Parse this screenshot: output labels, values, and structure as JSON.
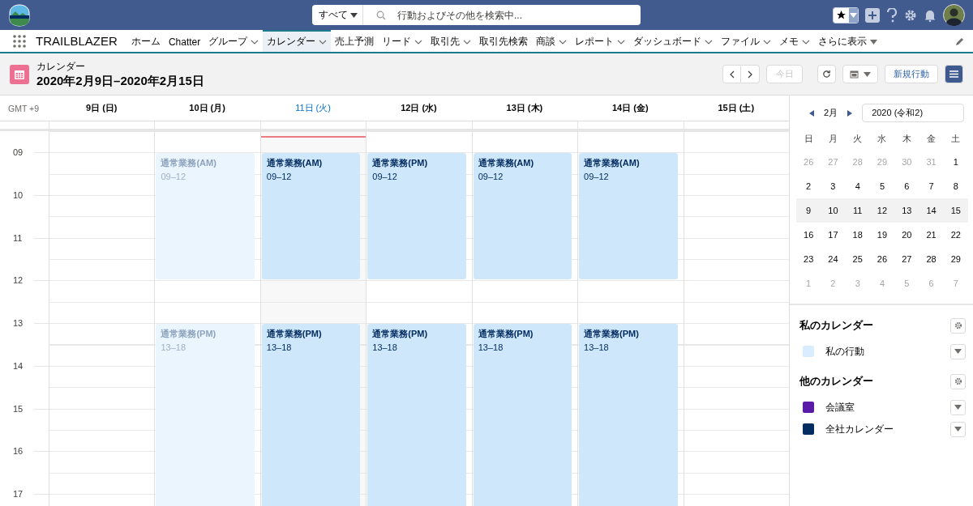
{
  "top_bar": {
    "search": {
      "scope": "すべて",
      "placeholder": "行動およびその他を検索中..."
    }
  },
  "nav": {
    "app_name": "TRAILBLAZER",
    "items": [
      {
        "label": "ホーム",
        "selected": false,
        "kind": "plain"
      },
      {
        "label": "Chatter",
        "selected": false,
        "kind": "plain"
      },
      {
        "label": "グループ",
        "selected": false,
        "kind": "menu"
      },
      {
        "label": "カレンダー",
        "selected": true,
        "kind": "menu"
      },
      {
        "label": "売上予測",
        "selected": false,
        "kind": "plain"
      },
      {
        "label": "リード",
        "selected": false,
        "kind": "menu"
      },
      {
        "label": "取引先",
        "selected": false,
        "kind": "menu"
      },
      {
        "label": "取引先検索",
        "selected": false,
        "kind": "plain"
      },
      {
        "label": "商談",
        "selected": false,
        "kind": "menu"
      },
      {
        "label": "レポート",
        "selected": false,
        "kind": "menu"
      },
      {
        "label": "ダッシュボード",
        "selected": false,
        "kind": "menu"
      },
      {
        "label": "ファイル",
        "selected": false,
        "kind": "menu"
      },
      {
        "label": "メモ",
        "selected": false,
        "kind": "menu"
      },
      {
        "label": "さらに表示",
        "selected": false,
        "kind": "more"
      }
    ]
  },
  "header": {
    "object_label": "カレンダー",
    "title": "2020年2月9日–2020年2月15日",
    "today_button": {
      "label": "今日",
      "disabled": true
    },
    "new_button": "新規行動"
  },
  "week": {
    "timezone": "GMT +9",
    "hours": [
      "09",
      "10",
      "11",
      "12",
      "13",
      "14",
      "15",
      "16",
      "17"
    ],
    "days": [
      {
        "label": "9日 (日)",
        "today": false
      },
      {
        "label": "10日 (月)",
        "today": false,
        "events": [
          {
            "title": "通常業務(AM)",
            "time": "09–12",
            "past": true
          },
          {
            "title": "通常業務(PM)",
            "time": "13–18",
            "past": true
          }
        ]
      },
      {
        "label": "11日 (火)",
        "today": true,
        "events": [
          {
            "title": "通常業務(AM)",
            "time": "09–12",
            "past": false
          },
          {
            "title": "通常業務(PM)",
            "time": "13–18",
            "past": false
          }
        ]
      },
      {
        "label": "12日 (水)",
        "today": false,
        "events": [
          {
            "title": "通常業務(PM)",
            "time": "09–12",
            "past": false
          },
          {
            "title": "通常業務(PM)",
            "time": "13–18",
            "past": false
          }
        ]
      },
      {
        "label": "13日 (木)",
        "today": false,
        "events": [
          {
            "title": "通常業務(AM)",
            "time": "09–12",
            "past": false
          },
          {
            "title": "通常業務(PM)",
            "time": "13–18",
            "past": false
          }
        ]
      },
      {
        "label": "14日 (金)",
        "today": false,
        "events": [
          {
            "title": "通常業務(AM)",
            "time": "09–12",
            "past": false
          },
          {
            "title": "通常業務(PM)",
            "time": "13–18",
            "past": false
          }
        ]
      },
      {
        "label": "15日 (土)",
        "today": false
      }
    ]
  },
  "mini_calendar": {
    "month": "2月",
    "year": "2020 (令和2)",
    "weekdays": [
      "日",
      "月",
      "火",
      "水",
      "木",
      "金",
      "土"
    ],
    "weeks": [
      {
        "selected": false,
        "days": [
          {
            "label": "26",
            "muted": true
          },
          {
            "label": "27",
            "muted": true
          },
          {
            "label": "28",
            "muted": true
          },
          {
            "label": "29",
            "muted": true
          },
          {
            "label": "30",
            "muted": true
          },
          {
            "label": "31",
            "muted": true
          },
          {
            "label": "1",
            "muted": false
          }
        ]
      },
      {
        "selected": false,
        "days": [
          {
            "label": "2",
            "muted": false
          },
          {
            "label": "3",
            "muted": false
          },
          {
            "label": "4",
            "muted": false
          },
          {
            "label": "5",
            "muted": false
          },
          {
            "label": "6",
            "muted": false
          },
          {
            "label": "7",
            "muted": false
          },
          {
            "label": "8",
            "muted": false
          }
        ]
      },
      {
        "selected": true,
        "days": [
          {
            "label": "9",
            "muted": false
          },
          {
            "label": "10",
            "muted": false
          },
          {
            "label": "11",
            "muted": false
          },
          {
            "label": "12",
            "muted": false
          },
          {
            "label": "13",
            "muted": false
          },
          {
            "label": "14",
            "muted": false
          },
          {
            "label": "15",
            "muted": false
          }
        ]
      },
      {
        "selected": false,
        "days": [
          {
            "label": "16",
            "muted": false
          },
          {
            "label": "17",
            "muted": false
          },
          {
            "label": "18",
            "muted": false
          },
          {
            "label": "19",
            "muted": false
          },
          {
            "label": "20",
            "muted": false
          },
          {
            "label": "21",
            "muted": false
          },
          {
            "label": "22",
            "muted": false
          }
        ]
      },
      {
        "selected": false,
        "days": [
          {
            "label": "23",
            "muted": false
          },
          {
            "label": "24",
            "muted": false
          },
          {
            "label": "25",
            "muted": false
          },
          {
            "label": "26",
            "muted": false
          },
          {
            "label": "27",
            "muted": false
          },
          {
            "label": "28",
            "muted": false
          },
          {
            "label": "29",
            "muted": false
          }
        ]
      },
      {
        "selected": false,
        "days": [
          {
            "label": "1",
            "muted": true
          },
          {
            "label": "2",
            "muted": true
          },
          {
            "label": "3",
            "muted": true
          },
          {
            "label": "4",
            "muted": true
          },
          {
            "label": "5",
            "muted": true
          },
          {
            "label": "6",
            "muted": true
          },
          {
            "label": "7",
            "muted": true
          }
        ]
      }
    ]
  },
  "calendar_groups": [
    {
      "title": "私のカレンダー",
      "items": [
        {
          "name": "私の行動",
          "color": "#d8edff"
        }
      ]
    },
    {
      "title": "他のカレンダー",
      "items": [
        {
          "name": "会議室",
          "color": "#5a1ba9"
        },
        {
          "name": "全社カレンダー",
          "color": "#032d60"
        }
      ]
    }
  ]
}
